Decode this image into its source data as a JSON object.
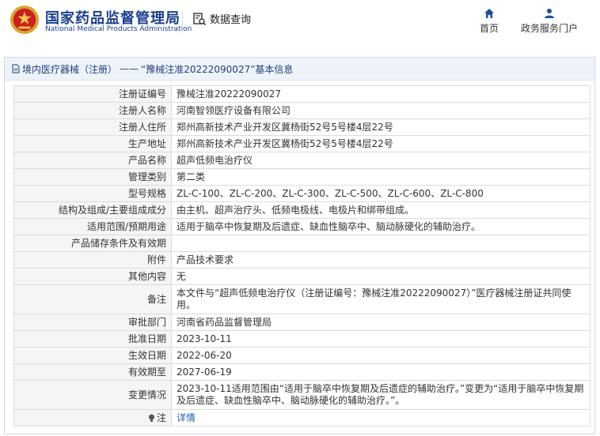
{
  "header": {
    "brand_cn": "国家药品监督管理局",
    "brand_en": "National Medical Products Administration",
    "data_query": "数据查询",
    "nav": [
      {
        "label": "首页",
        "icon": "home-icon"
      },
      {
        "label": "政务服务门户",
        "icon": "user-icon"
      }
    ]
  },
  "breadcrumb": {
    "part1": "境内医疗器械（注册）",
    "sep": "——",
    "part2": "“豫械注准20222090027”基本信息"
  },
  "rows": [
    {
      "k": "注册证编号",
      "v": "豫械注准20222090027"
    },
    {
      "k": "注册人名称",
      "v": "河南智领医疗设备有限公司"
    },
    {
      "k": "注册人住所",
      "v": "郑州高新技术产业开发区冀杨街52号5号楼4层22号"
    },
    {
      "k": "生产地址",
      "v": "郑州高新技术产业开发区冀杨街52号5号楼4层22号"
    },
    {
      "k": "产品名称",
      "v": "超声低频电治疗仪"
    },
    {
      "k": "管理类别",
      "v": "第二类"
    },
    {
      "k": "型号规格",
      "v": "ZL-C-100、ZL-C-200、ZL-C-300、ZL-C-500、ZL-C-600、ZL-C-800"
    },
    {
      "k": "结构及组成/主要组成成分",
      "v": "由主机、超声治疗头、低频电极线、电极片和绑带组成。"
    },
    {
      "k": "适用范围/预期用途",
      "v": "适用于脑卒中恢复期及后遗症、缺血性脑卒中、脑动脉硬化的辅助治疗。"
    },
    {
      "k": "产品储存条件及有效期",
      "v": ""
    },
    {
      "k": "附件",
      "v": "产品技术要求"
    },
    {
      "k": "其他内容",
      "v": "无"
    },
    {
      "k": "备注",
      "v": "本文件与“超声低频电治疗仪（注册证编号：豫械注准20222090027）”医疗器械注册证共同使用。"
    },
    {
      "k": "审批部门",
      "v": "河南省药品监督管理局"
    },
    {
      "k": "批准日期",
      "v": "2023-10-11"
    },
    {
      "k": "生效日期",
      "v": "2022-06-20"
    },
    {
      "k": "有效期至",
      "v": "2027-06-19"
    },
    {
      "k": "变更情况",
      "v": "2023-10-11适用范围由“适用于脑卒中恢复期及后遗症的辅助治疗。”变更为“适用于脑卒中恢复期及后遗症、缺血性脑卒中、脑动脉硬化的辅助治疗。”。"
    }
  ],
  "note_row": {
    "k": "注",
    "v": "详情"
  },
  "colors": {
    "brand": "#1a3f91",
    "link": "#1f5fb0",
    "label_bg": "#f5f5f5"
  }
}
